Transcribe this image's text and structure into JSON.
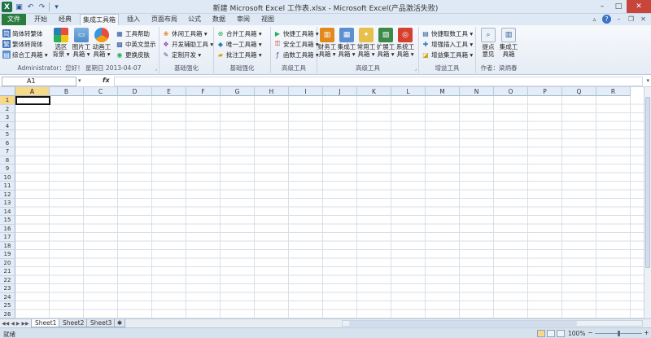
{
  "window": {
    "title": "新建 Microsoft Excel 工作表.xlsx - Microsoft Excel(产品激活失败)",
    "logo": "X"
  },
  "tabs": [
    {
      "label": "文件"
    },
    {
      "label": "开始"
    },
    {
      "label": "经典"
    },
    {
      "label": "集成工具箱"
    },
    {
      "label": "插入"
    },
    {
      "label": "页面布局"
    },
    {
      "label": "公式"
    },
    {
      "label": "数据"
    },
    {
      "label": "审阅"
    },
    {
      "label": "视图"
    }
  ],
  "ribbon": {
    "g1": {
      "items": [
        "简体转繁体",
        "繁体转简体",
        "综合工具箱 ▾"
      ],
      "big": [
        {
          "label": "选区\n背景 ▾"
        },
        {
          "label": "图片工\n具箱 ▾"
        },
        {
          "label": "动画工\n具箱 ▾"
        }
      ],
      "right": [
        "工具帮助",
        "中英文显示",
        "更换皮肤"
      ],
      "label": "Administrator：您好！ 星期日  2013-04-07"
    },
    "g2": {
      "items": [
        "休闲工具箱 ▾",
        "开发辅助工具 ▾",
        "定制开发 ▾"
      ],
      "label": "基础强化"
    },
    "g3": {
      "items": [
        "合并工具箱 ▾",
        "唯一工具箱 ▾",
        "批注工具箱 ▾"
      ],
      "label": "基础强化"
    },
    "g4": {
      "items": [
        "快捷工具箱 ▾",
        "安全工具箱 ▾",
        "函数工具箱 ▾"
      ],
      "label": "高级工具"
    },
    "g5": {
      "big": [
        {
          "label": "财务工\n具箱 ▾"
        },
        {
          "label": "集成工\n具箱 ▾"
        },
        {
          "label": "常用工\n具箱 ▾"
        },
        {
          "label": "扩展工\n具箱 ▾"
        },
        {
          "label": "系统工\n具箱 ▾"
        }
      ],
      "label": "高级工具"
    },
    "g6": {
      "items": [
        "快捷取数工具 ▾",
        "增强插入工具 ▾",
        "增益集工具箱 ▾"
      ],
      "label": "增益工具"
    },
    "g7": {
      "big": [
        {
          "label": "提点\n意见"
        },
        {
          "label": "集成工\n具箱"
        }
      ],
      "label": "作者：梁炳春"
    }
  },
  "formula_bar": {
    "name_box": "A1",
    "fx": "fx",
    "formula": ""
  },
  "grid": {
    "columns": [
      "A",
      "B",
      "C",
      "D",
      "E",
      "F",
      "G",
      "H",
      "I",
      "J",
      "K",
      "L",
      "M",
      "N",
      "O",
      "P",
      "Q",
      "R"
    ],
    "rows": [
      "1",
      "2",
      "3",
      "4",
      "5",
      "6",
      "7",
      "8",
      "9",
      "10",
      "11",
      "12",
      "13",
      "14",
      "15",
      "16",
      "17",
      "18",
      "19",
      "20",
      "21",
      "22",
      "23",
      "24",
      "25",
      "26"
    ]
  },
  "sheets": [
    {
      "label": "Sheet1"
    },
    {
      "label": "Sheet2"
    },
    {
      "label": "Sheet3"
    }
  ],
  "status": {
    "ready": "就绪",
    "zoom": "100%",
    "zoom_minus": "−",
    "zoom_plus": "+"
  }
}
